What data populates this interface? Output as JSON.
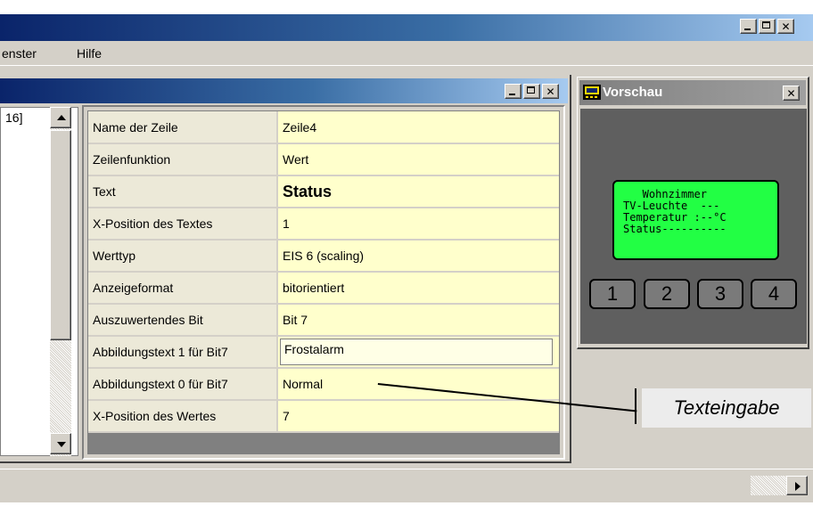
{
  "menubar": {
    "items": [
      "enster",
      "Hilfe"
    ]
  },
  "tree": {
    "visible_text": "16]"
  },
  "properties": [
    {
      "label": "Name der Zeile",
      "value": "Zeile4"
    },
    {
      "label": "Zeilenfunktion",
      "value": "Wert"
    },
    {
      "label": "Text",
      "value": "Status"
    },
    {
      "label": "X-Position des Textes",
      "value": "1"
    },
    {
      "label": "Werttyp",
      "value": "EIS 6 (scaling)"
    },
    {
      "label": "Anzeigeformat",
      "value": "bitorientiert"
    },
    {
      "label": "Auszuwertendes Bit",
      "value": "Bit 7"
    },
    {
      "label": "Abbildungstext 1 für Bit7",
      "value": "Frostalarm"
    },
    {
      "label": "Abbildungstext 0 für Bit7",
      "value": "Normal"
    },
    {
      "label": "X-Position des Wertes",
      "value": "7"
    }
  ],
  "preview": {
    "title": "Vorschau",
    "lcd_lines": [
      "   Wohnzimmer",
      "TV-Leuchte  ---",
      "Temperatur :--°C",
      "Status----------"
    ],
    "keys": [
      "1",
      "2",
      "3",
      "4"
    ],
    "colors": {
      "lcd": "#22ff44",
      "body": "#5f5f5f"
    }
  },
  "annotation": {
    "label": "Texteingabe"
  },
  "icons": [
    "minimize-icon",
    "maximize-icon",
    "close-icon",
    "scroll-up-icon",
    "scroll-down-icon",
    "scroll-right-icon",
    "preview-app-icon"
  ]
}
